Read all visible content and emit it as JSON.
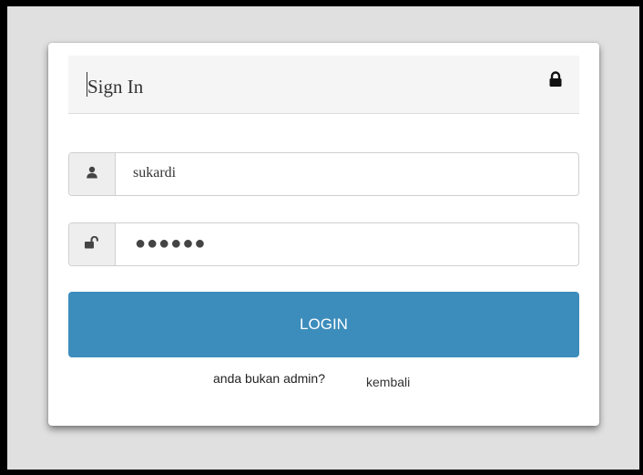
{
  "header": {
    "title": "Sign In",
    "icon": "lock-icon"
  },
  "username": {
    "value": "sukardi",
    "icon": "user-icon"
  },
  "password": {
    "masked_value": "●●●●●●",
    "icon": "unlock-icon"
  },
  "login_button": {
    "label": "LOGIN",
    "color": "#3c8dbc"
  },
  "footer": {
    "question": "anda bukan admin?",
    "link_label": "kembali"
  }
}
